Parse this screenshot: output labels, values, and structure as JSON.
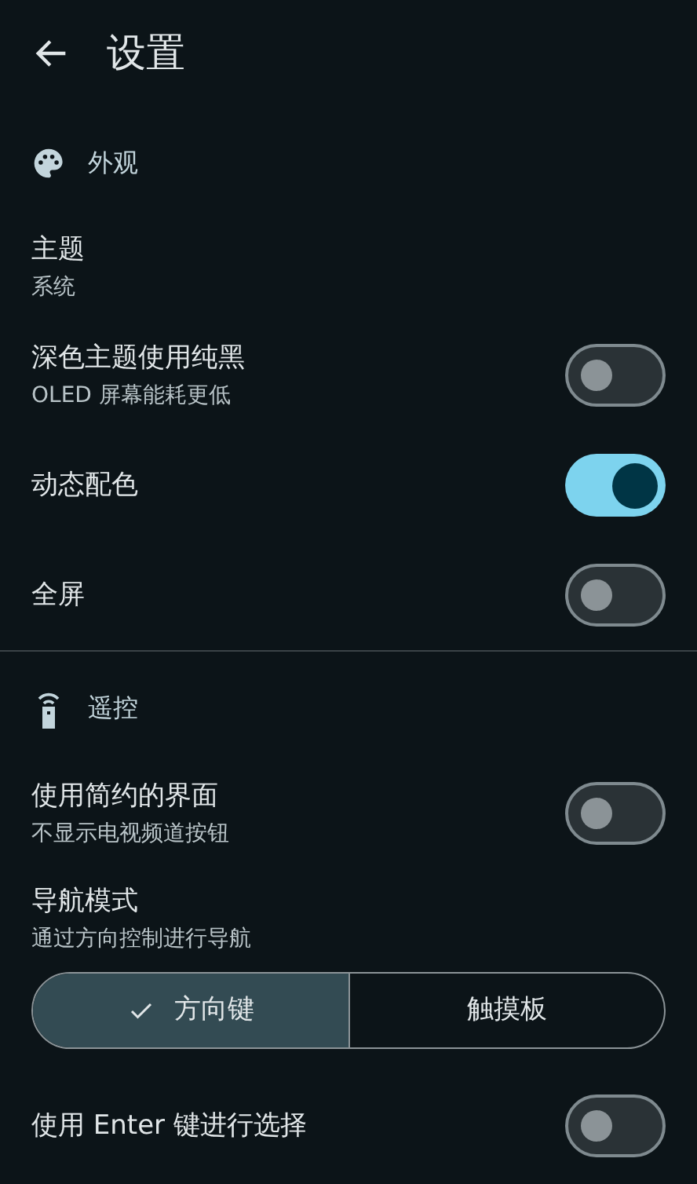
{
  "app_bar": {
    "title": "设置"
  },
  "sections": [
    {
      "title": "外观",
      "items": [
        {
          "kind": "select",
          "title": "主题",
          "summary": "系统"
        },
        {
          "kind": "switch",
          "title": "深色主题使用纯黑",
          "summary": "OLED 屏幕能耗更低",
          "on": false
        },
        {
          "kind": "switch",
          "title": "动态配色",
          "on": true
        },
        {
          "kind": "switch",
          "title": "全屏",
          "on": false
        }
      ]
    },
    {
      "title": "遥控",
      "items": [
        {
          "kind": "switch",
          "title": "使用简约的界面",
          "summary": "不显示电视频道按钮",
          "on": false
        },
        {
          "kind": "segmented",
          "title": "导航模式",
          "summary": "通过方向控制进行导航",
          "options": [
            {
              "label": "方向键",
              "selected": true
            },
            {
              "label": "触摸板",
              "selected": false
            }
          ]
        },
        {
          "kind": "switch",
          "title": "使用 Enter 键进行选择",
          "on": false
        }
      ]
    }
  ]
}
